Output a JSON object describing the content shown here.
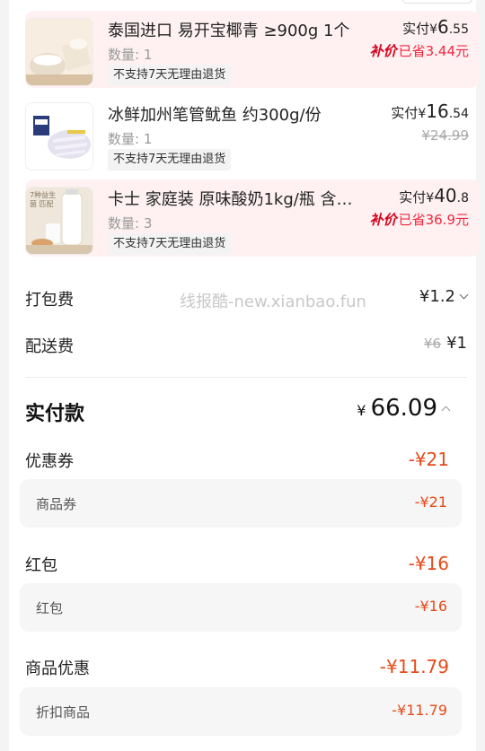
{
  "items": [
    {
      "name": "泰国进口 易开宝椰青 ≥900g 1个",
      "qty": "数量: 1",
      "tag": "不支持7天无理由退货",
      "paid_label": "实付",
      "paid_currency": "¥",
      "paid_int": "6",
      "paid_dec": ".55",
      "save_badge": "补价",
      "save_text": "已省3.44元",
      "orig_price": "",
      "image_icon": "coconut-image"
    },
    {
      "name": "冰鲜加州笔管鱿鱼 约300g/份",
      "qty": "数量: 1",
      "tag": "不支持7天无理由退货",
      "paid_label": "实付",
      "paid_currency": "¥",
      "paid_int": "16",
      "paid_dec": ".54",
      "save_badge": "",
      "save_text": "",
      "orig_price": "¥24.99",
      "image_icon": "squid-image"
    },
    {
      "name": "卡士 家庭装 原味酸奶1kg/瓶 含…",
      "qty": "数量: 3",
      "tag": "不支持7天无理由退货",
      "paid_label": "实付",
      "paid_currency": "¥",
      "paid_int": "40",
      "paid_dec": ".8",
      "save_badge": "补价",
      "save_text": "已省36.9元",
      "orig_price": "",
      "image_icon": "yogurt-image",
      "image_caption": "7种益生菌 匹配"
    }
  ],
  "fees": {
    "packing_label": "打包费",
    "packing_value": "¥1.2",
    "delivery_label": "配送费",
    "delivery_orig": "¥6",
    "delivery_value": "¥1"
  },
  "watermark": "线报酷-new.xianbao.fun",
  "total": {
    "label": "实付款",
    "currency": "¥",
    "value": "66.09"
  },
  "discounts": [
    {
      "label": "优惠券",
      "value": "-¥21",
      "sub_label": "商品券",
      "sub_value": "-¥21"
    },
    {
      "label": "红包",
      "value": "-¥16",
      "sub_label": "红包",
      "sub_value": "-¥16"
    },
    {
      "label": "商品优惠",
      "value": "-¥11.79",
      "sub_label": "折扣商品",
      "sub_value": "-¥11.79"
    }
  ],
  "colors": {
    "accent_red": "#f2273e",
    "discount_orange": "#e64a19",
    "highlight_bg": "#fff1f2"
  }
}
